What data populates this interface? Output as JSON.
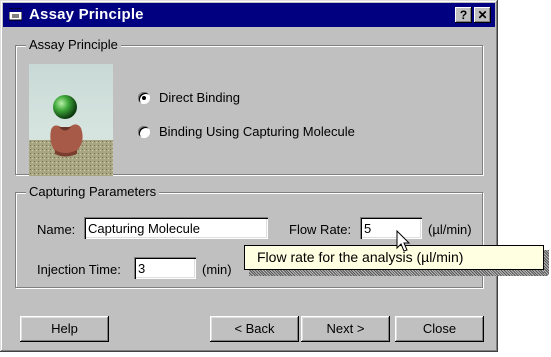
{
  "window": {
    "title": "Assay Principle",
    "help_button": "?",
    "close_button": "✕"
  },
  "assay_group": {
    "legend": "Assay Principle",
    "options": [
      {
        "label": "Direct Binding",
        "selected": true
      },
      {
        "label": "Binding Using Capturing Molecule",
        "selected": false
      }
    ]
  },
  "capture_group": {
    "legend": "Capturing Parameters",
    "name_label": "Name:",
    "name_value": "Capturing Molecule",
    "flow_rate_label": "Flow Rate:",
    "flow_rate_value": "5",
    "flow_rate_unit": "(µl/min)",
    "injection_label": "Injection Time:",
    "injection_value": "3",
    "injection_unit": "(min)"
  },
  "tooltip": "Flow rate for the analysis (µl/min)",
  "buttons": {
    "help": "Help",
    "back": "< Back",
    "next": "Next >",
    "close": "Close"
  },
  "colors": {
    "title_bar": "#000080",
    "face": "#c0c0c0",
    "tooltip_bg": "#ffffe1"
  },
  "icons": [
    "window-app-icon",
    "help-question-icon",
    "close-x-icon",
    "mouse-pointer-icon"
  ]
}
